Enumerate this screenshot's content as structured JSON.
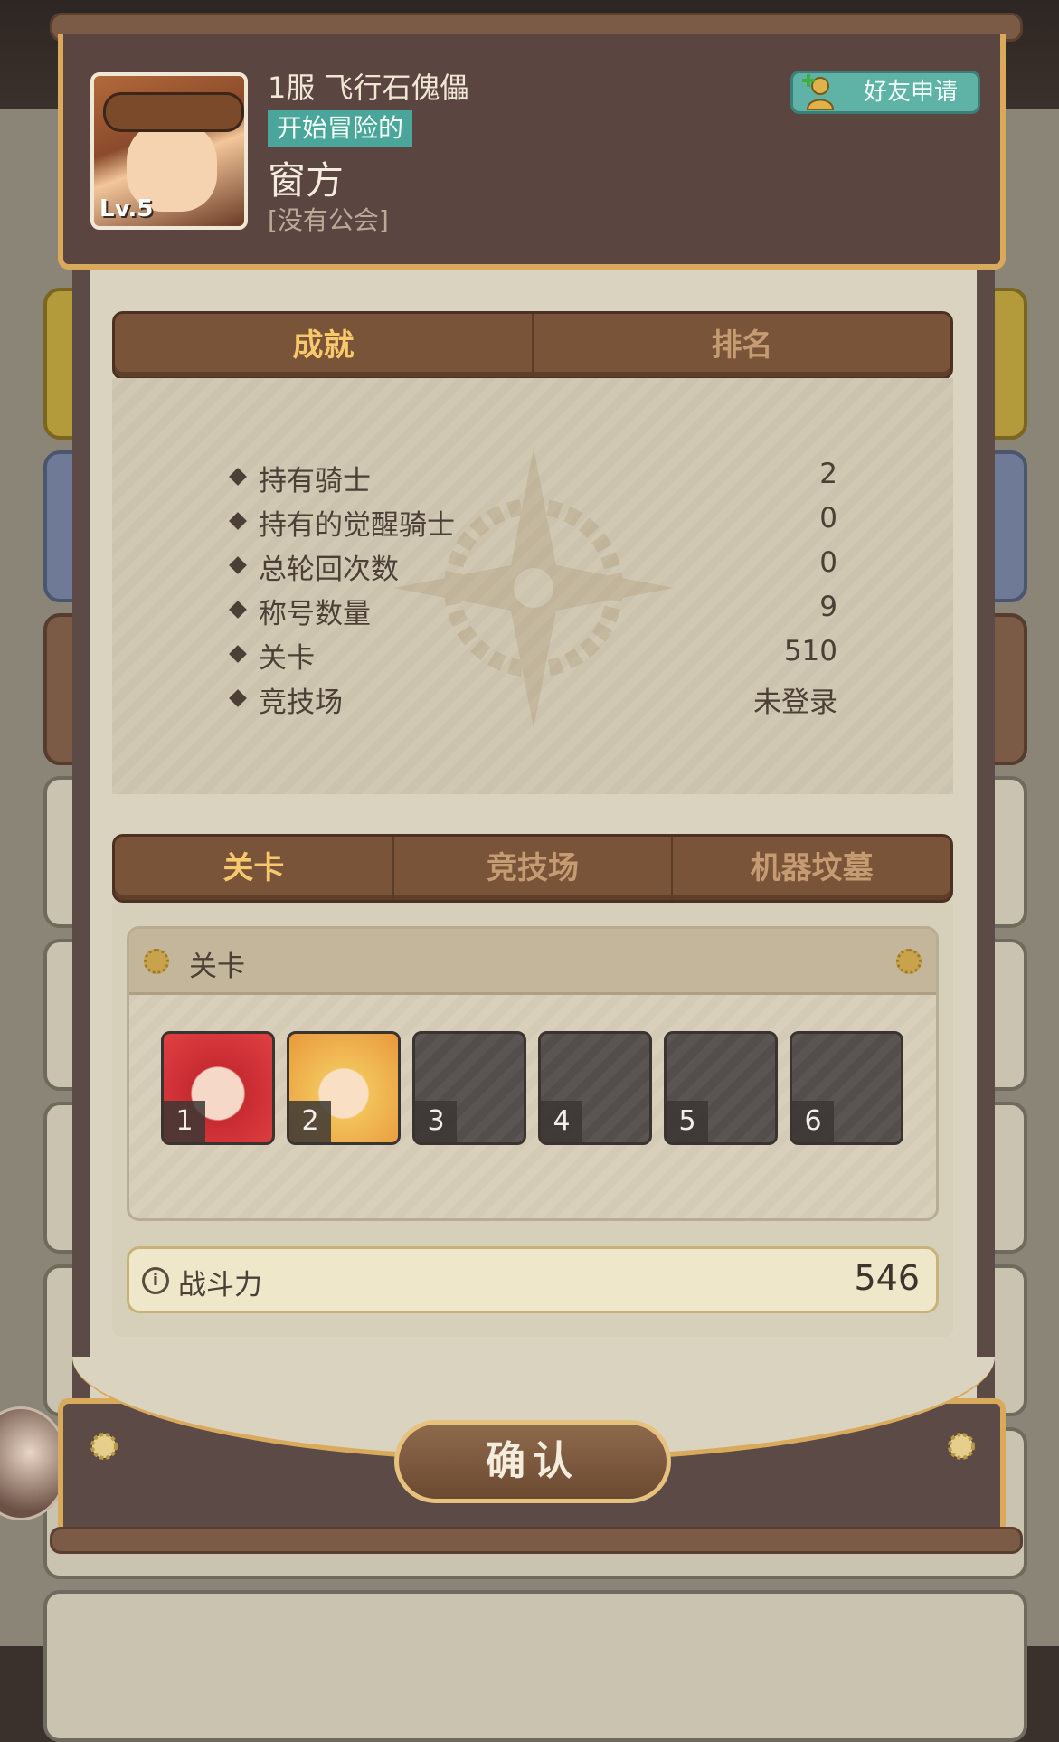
{
  "profile": {
    "level_label": "Lv.5",
    "server_name": "1服 飞行石傀儡",
    "title_badge": "开始冒险的",
    "player_name": "窗方",
    "guild_name": "[没有公会]",
    "friend_request_label": "好友申请"
  },
  "stats_tabs": [
    {
      "label": "成就",
      "active": true
    },
    {
      "label": "排名",
      "active": false
    }
  ],
  "stats": [
    {
      "name": "持有骑士",
      "value": "2"
    },
    {
      "name": "持有的觉醒骑士",
      "value": "0"
    },
    {
      "name": "总轮回次数",
      "value": "0"
    },
    {
      "name": "称号数量",
      "value": "9"
    },
    {
      "name": "关卡",
      "value": "510"
    },
    {
      "name": "竞技场",
      "value": "未登录"
    }
  ],
  "team_tabs": [
    {
      "label": "关卡",
      "active": true
    },
    {
      "label": "竞技场",
      "active": false
    },
    {
      "label": "机器坟墓",
      "active": false
    }
  ],
  "team_panel": {
    "title": "关卡",
    "slots": [
      {
        "number": "1",
        "filled": true
      },
      {
        "number": "2",
        "filled": true
      },
      {
        "number": "3",
        "filled": false
      },
      {
        "number": "4",
        "filled": false
      },
      {
        "number": "5",
        "filled": false
      },
      {
        "number": "6",
        "filled": false
      }
    ]
  },
  "power": {
    "label": "战斗力",
    "value": "546"
  },
  "confirm_label": "确认",
  "colors": {
    "accent_gold": "#d9a95c",
    "tab_active": "#f7c86c",
    "badge_teal": "#4aa59a",
    "panel_brown": "#5b4a45"
  }
}
